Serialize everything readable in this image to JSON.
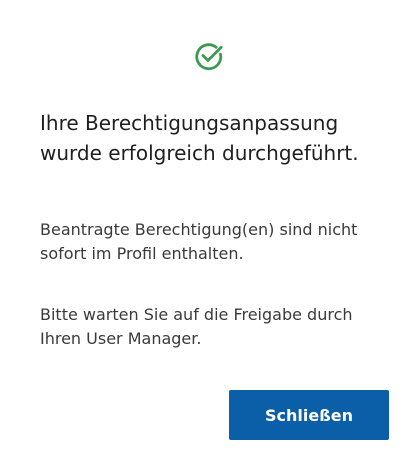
{
  "dialog": {
    "headline": "Ihre Berechtigungsanpassung wurde erfolgreich durchgeführt.",
    "message_1": "Beantragte Berechtigung(en) sind nicht sofort im Profil enthalten.",
    "message_2": "Bitte warten Sie auf die Freigabe durch Ihren User Manager.",
    "close_button_label": "Schließen",
    "icon": "check-circle-icon"
  },
  "colors": {
    "success": "#3a9a52",
    "button_bg": "#0b5ea8",
    "button_text": "#ffffff",
    "text": "#1f1f1f"
  }
}
